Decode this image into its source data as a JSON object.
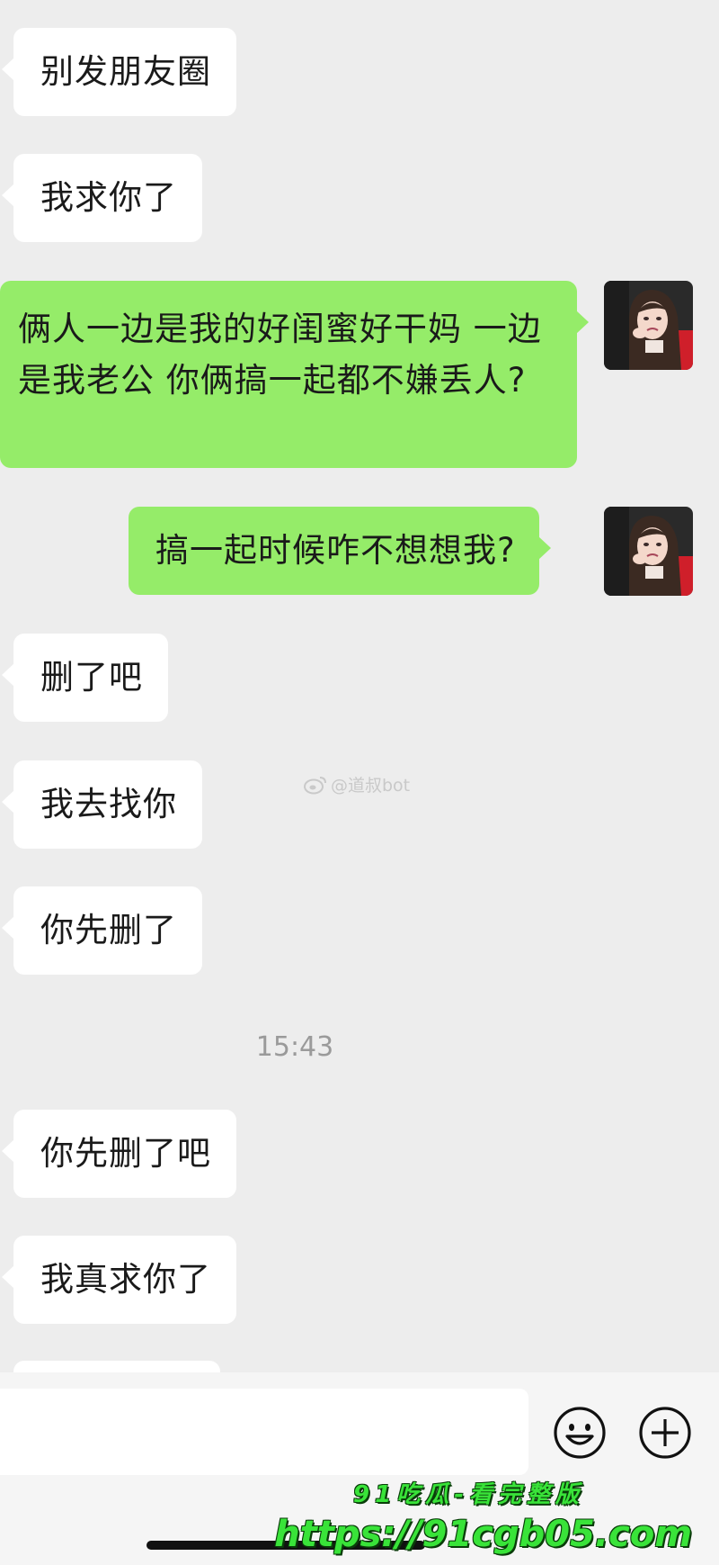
{
  "messages": [
    {
      "side": "in",
      "text": "别发朋友圈"
    },
    {
      "side": "in",
      "text": "我求你了"
    },
    {
      "side": "out",
      "text": "俩人一边是我的好闺蜜好干妈 一边是我老公 你俩搞一起都不嫌丢人?"
    },
    {
      "side": "out",
      "text": "搞一起时候咋不想想我?"
    },
    {
      "side": "in",
      "text": "删了吧"
    },
    {
      "side": "in",
      "text": "我去找你"
    },
    {
      "side": "in",
      "text": "你先删了"
    },
    {
      "side": "in",
      "text": "你先删了吧"
    },
    {
      "side": "in",
      "text": "我真求你了"
    }
  ],
  "timestamp": "15:43",
  "watermark": "@道叔bot",
  "toolbar": {
    "emoji_icon": "emoji-icon",
    "add_icon": "plus-circle-icon"
  },
  "overlay": {
    "line1": "91吃瓜-看完整版",
    "line2": "https://91cgb05.com"
  },
  "colors": {
    "background": "#ededed",
    "incoming_bubble": "#ffffff",
    "outgoing_bubble": "#95ec69",
    "promo_text": "#39e339"
  }
}
